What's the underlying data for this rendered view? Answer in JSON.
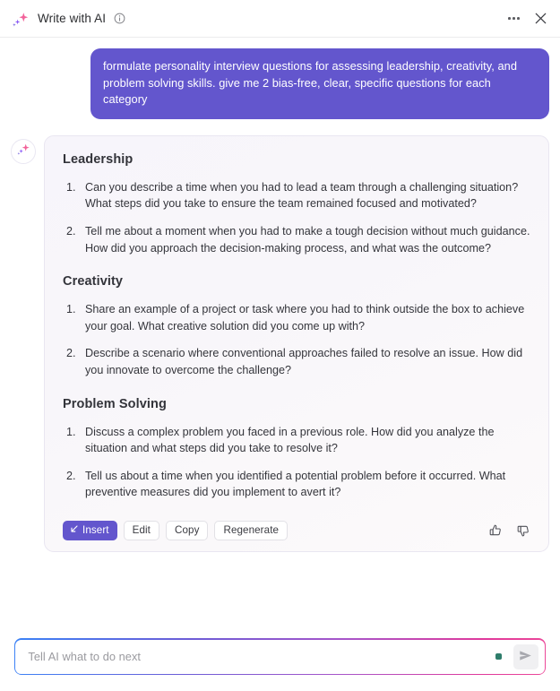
{
  "header": {
    "title": "Write with AI",
    "sparkle_icon": "sparkle-icon",
    "info_icon": "info-circle-icon",
    "more_icon": "more-horizontal-icon",
    "close_icon": "close-icon"
  },
  "user_message": {
    "text": "formulate personality interview questions for assessing leadership, creativity, and problem solving skills. give me 2 bias-free, clear, specific questions for each category"
  },
  "answer": {
    "avatar_icon": "sparkle-icon",
    "sections": [
      {
        "title": "Leadership",
        "questions": [
          "Can you describe a time when you had to lead a team through a challenging situation? What steps did you take to ensure the team remained focused and motivated?",
          "Tell me about a moment when you had to make a tough decision without much guidance. How did you approach the decision-making process, and what was the outcome?"
        ]
      },
      {
        "title": "Creativity",
        "questions": [
          "Share an example of a project or task where you had to think outside the box to achieve your goal. What creative solution did you come up with?",
          "Describe a scenario where conventional approaches failed to resolve an issue. How did you innovate to overcome the challenge?"
        ]
      },
      {
        "title": "Problem Solving",
        "questions": [
          "Discuss a complex problem you faced in a previous role. How did you analyze the situation and what steps did you take to resolve it?",
          "Tell us about a time when you identified a potential problem before it occurred. What preventive measures did you implement to avert it?"
        ]
      }
    ]
  },
  "actions": {
    "insert_label": "Insert",
    "insert_icon": "arrow-down-left-icon",
    "edit_label": "Edit",
    "copy_label": "Copy",
    "regenerate_label": "Regenerate",
    "thumbs_up_icon": "thumbs-up-icon",
    "thumbs_down_icon": "thumbs-down-icon"
  },
  "composer": {
    "placeholder": "Tell AI what to do next",
    "value": "",
    "status_dot_color": "#2e7d6b",
    "send_icon": "send-paper-plane-icon"
  },
  "colors": {
    "accent_purple": "#6356cd",
    "card_bg_start": "#f7f5fb",
    "card_border": "#e9e6f1"
  }
}
